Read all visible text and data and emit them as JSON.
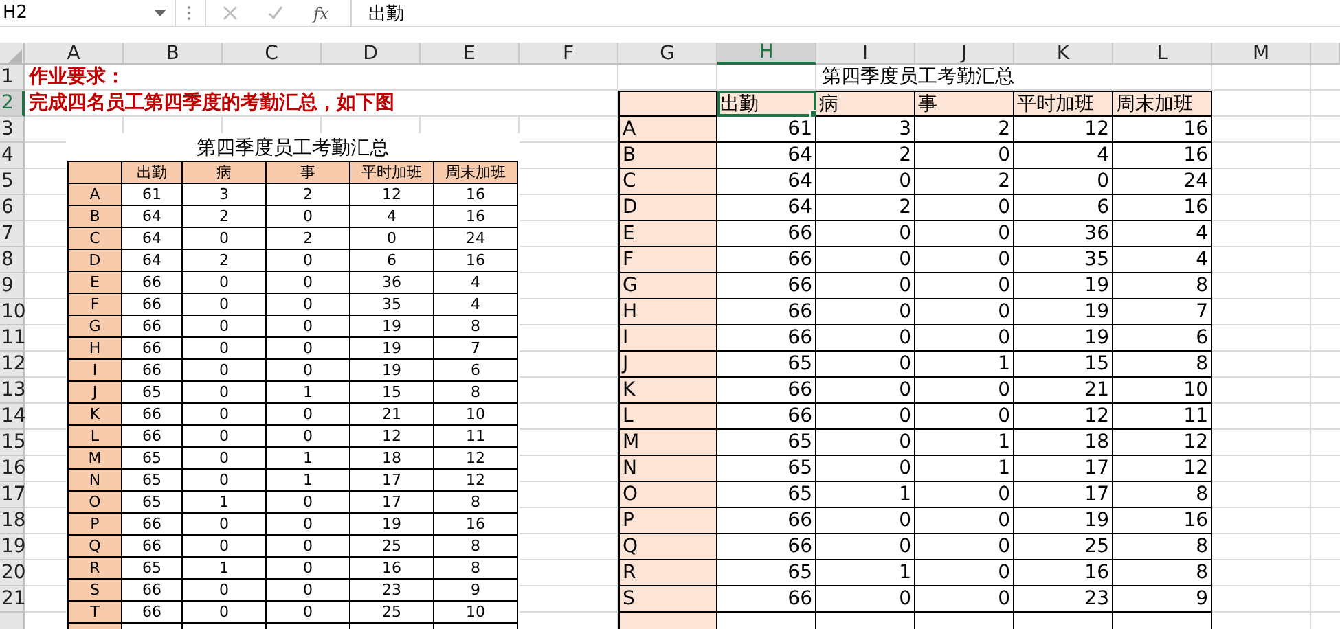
{
  "formula_bar": {
    "name_box": "H2",
    "function_label": "fx",
    "formula": "出勤"
  },
  "columns": [
    {
      "label": "A",
      "selected": false
    },
    {
      "label": "B",
      "selected": false
    },
    {
      "label": "C",
      "selected": false
    },
    {
      "label": "D",
      "selected": false
    },
    {
      "label": "E",
      "selected": false
    },
    {
      "label": "F",
      "selected": false
    },
    {
      "label": "G",
      "selected": false
    },
    {
      "label": "H",
      "selected": true
    },
    {
      "label": "I",
      "selected": false
    },
    {
      "label": "J",
      "selected": false
    },
    {
      "label": "K",
      "selected": false
    },
    {
      "label": "L",
      "selected": false
    },
    {
      "label": "M",
      "selected": false
    }
  ],
  "row_numbers": [
    {
      "label": "1",
      "selected": false
    },
    {
      "label": "2",
      "selected": true
    },
    {
      "label": "3",
      "selected": false
    },
    {
      "label": "4",
      "selected": false
    },
    {
      "label": "5",
      "selected": false
    },
    {
      "label": "6",
      "selected": false
    },
    {
      "label": "7",
      "selected": false
    },
    {
      "label": "8",
      "selected": false
    },
    {
      "label": "9",
      "selected": false
    },
    {
      "label": "10",
      "selected": false
    },
    {
      "label": "11",
      "selected": false
    },
    {
      "label": "12",
      "selected": false
    },
    {
      "label": "13",
      "selected": false
    },
    {
      "label": "14",
      "selected": false
    },
    {
      "label": "15",
      "selected": false
    },
    {
      "label": "16",
      "selected": false
    },
    {
      "label": "17",
      "selected": false
    },
    {
      "label": "18",
      "selected": false
    },
    {
      "label": "19",
      "selected": false
    },
    {
      "label": "20",
      "selected": false
    },
    {
      "label": "21",
      "selected": false
    }
  ],
  "notes": [
    "作业要求：",
    "完成四名员工第四季度的考勤汇总，如下图"
  ],
  "picture_table": {
    "title": "第四季度员工考勤汇总",
    "headers": [
      "出勤",
      "病",
      "事",
      "平时加班",
      "周末加班"
    ],
    "rows": [
      [
        "A",
        "61",
        "3",
        "2",
        "12",
        "16"
      ],
      [
        "B",
        "64",
        "2",
        "0",
        "4",
        "16"
      ],
      [
        "C",
        "64",
        "0",
        "2",
        "0",
        "24"
      ],
      [
        "D",
        "64",
        "2",
        "0",
        "6",
        "16"
      ],
      [
        "E",
        "66",
        "0",
        "0",
        "36",
        "4"
      ],
      [
        "F",
        "66",
        "0",
        "0",
        "35",
        "4"
      ],
      [
        "G",
        "66",
        "0",
        "0",
        "19",
        "8"
      ],
      [
        "H",
        "66",
        "0",
        "0",
        "19",
        "7"
      ],
      [
        "I",
        "66",
        "0",
        "0",
        "19",
        "6"
      ],
      [
        "J",
        "65",
        "0",
        "1",
        "15",
        "8"
      ],
      [
        "K",
        "66",
        "0",
        "0",
        "21",
        "10"
      ],
      [
        "L",
        "66",
        "0",
        "0",
        "12",
        "11"
      ],
      [
        "M",
        "65",
        "0",
        "1",
        "18",
        "12"
      ],
      [
        "N",
        "65",
        "0",
        "1",
        "17",
        "12"
      ],
      [
        "O",
        "65",
        "1",
        "0",
        "17",
        "8"
      ],
      [
        "P",
        "66",
        "0",
        "0",
        "19",
        "16"
      ],
      [
        "Q",
        "66",
        "0",
        "0",
        "25",
        "8"
      ],
      [
        "R",
        "65",
        "1",
        "0",
        "16",
        "8"
      ],
      [
        "S",
        "66",
        "0",
        "0",
        "23",
        "9"
      ],
      [
        "T",
        "66",
        "0",
        "0",
        "25",
        "10"
      ]
    ]
  },
  "sheet_table": {
    "title": "第四季度员工考勤汇总",
    "headers": [
      {
        "label": "出勤",
        "selected": true
      },
      {
        "label": "病",
        "selected": false
      },
      {
        "label": "事",
        "selected": false
      },
      {
        "label": "平时加班",
        "selected": false
      },
      {
        "label": "周末加班",
        "selected": false
      }
    ],
    "rows": [
      [
        "A",
        "61",
        "3",
        "2",
        "12",
        "16"
      ],
      [
        "B",
        "64",
        "2",
        "0",
        "4",
        "16"
      ],
      [
        "C",
        "64",
        "0",
        "2",
        "0",
        "24"
      ],
      [
        "D",
        "64",
        "2",
        "0",
        "6",
        "16"
      ],
      [
        "E",
        "66",
        "0",
        "0",
        "36",
        "4"
      ],
      [
        "F",
        "66",
        "0",
        "0",
        "35",
        "4"
      ],
      [
        "G",
        "66",
        "0",
        "0",
        "19",
        "8"
      ],
      [
        "H",
        "66",
        "0",
        "0",
        "19",
        "7"
      ],
      [
        "I",
        "66",
        "0",
        "0",
        "19",
        "6"
      ],
      [
        "J",
        "65",
        "0",
        "1",
        "15",
        "8"
      ],
      [
        "K",
        "66",
        "0",
        "0",
        "21",
        "10"
      ],
      [
        "L",
        "66",
        "0",
        "0",
        "12",
        "11"
      ],
      [
        "M",
        "65",
        "0",
        "1",
        "18",
        "12"
      ],
      [
        "N",
        "65",
        "0",
        "1",
        "17",
        "12"
      ],
      [
        "O",
        "65",
        "1",
        "0",
        "17",
        "8"
      ],
      [
        "P",
        "66",
        "0",
        "0",
        "19",
        "16"
      ],
      [
        "Q",
        "66",
        "0",
        "0",
        "25",
        "8"
      ],
      [
        "R",
        "65",
        "1",
        "0",
        "16",
        "8"
      ],
      [
        "S",
        "66",
        "0",
        "0",
        "23",
        "9"
      ]
    ]
  }
}
